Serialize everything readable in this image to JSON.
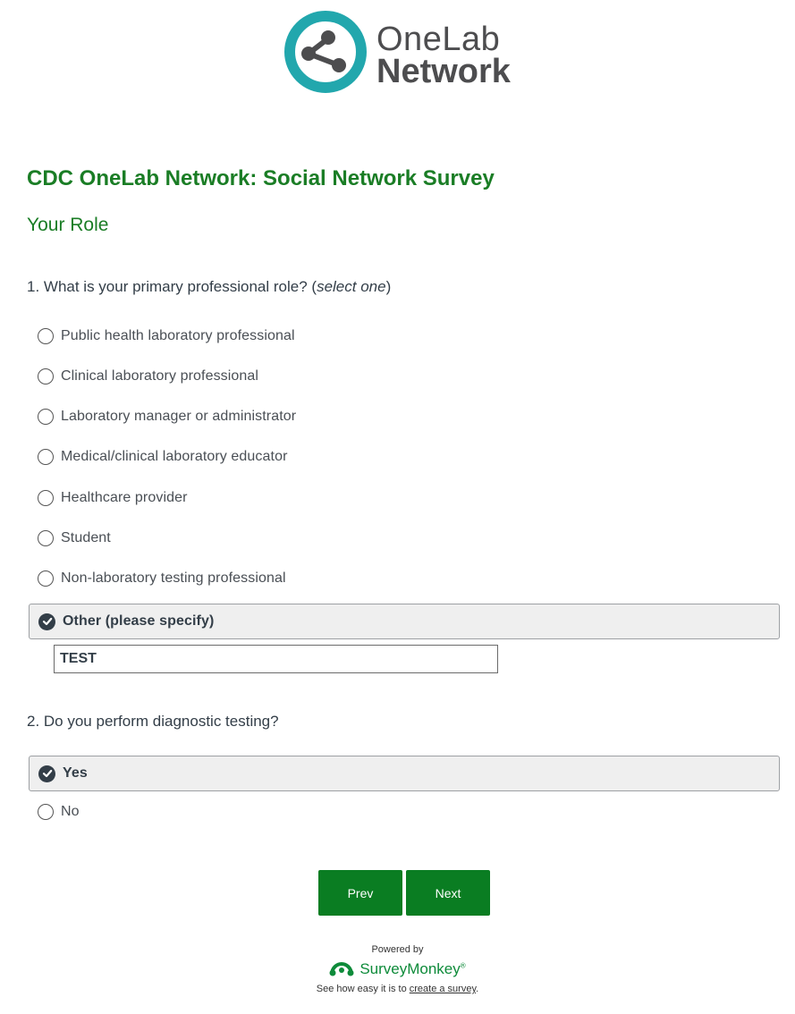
{
  "logo": {
    "line1": "OneLab",
    "line2": "Network",
    "colors": {
      "ring": "#22a7ad",
      "text": "#4d4d4f"
    }
  },
  "survey_title": "CDC OneLab Network: Social Network Survey",
  "page_title": "Your Role",
  "question1": {
    "title_prefix": "1. What is your primary professional role? (",
    "title_italic": "select one",
    "title_suffix": ")",
    "options": [
      {
        "label": "Public health laboratory professional",
        "selected": false
      },
      {
        "label": "Clinical laboratory professional",
        "selected": false
      },
      {
        "label": "Laboratory manager or administrator",
        "selected": false
      },
      {
        "label": "Medical/clinical laboratory educator",
        "selected": false
      },
      {
        "label": "Healthcare provider",
        "selected": false
      },
      {
        "label": "Student",
        "selected": false
      },
      {
        "label": "Non-laboratory testing professional",
        "selected": false
      },
      {
        "label": "Other (please specify)",
        "selected": true
      }
    ],
    "other_value": "TEST"
  },
  "question2": {
    "title": "2. Do you perform diagnostic testing?",
    "options": [
      {
        "label": "Yes",
        "selected": true
      },
      {
        "label": "No",
        "selected": false
      }
    ]
  },
  "nav": {
    "prev_label": "Prev",
    "next_label": "Next"
  },
  "footer": {
    "powered_by": "Powered by",
    "brand": "SurveyMonkey",
    "tm": "®",
    "create_prefix": "See how easy it is to ",
    "create_link": "create a survey",
    "create_suffix": "."
  },
  "colors": {
    "accent_green": "#1a7d25",
    "button_green": "#0a7d22",
    "selected_bg": "#efefef",
    "brand_green": "#0e8b3a"
  }
}
